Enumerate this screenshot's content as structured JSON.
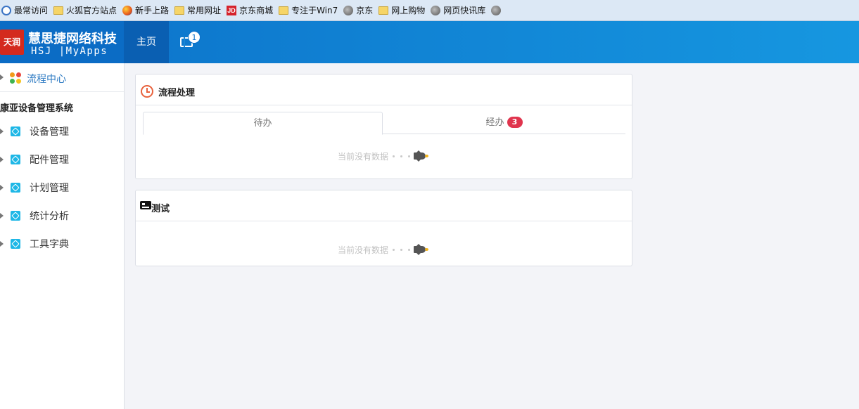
{
  "bookmarks": [
    {
      "label": "最常访问",
      "icon": "most-visited-icon"
    },
    {
      "label": "火狐官方站点",
      "icon": "folder-icon"
    },
    {
      "label": "新手上路",
      "icon": "firefox-icon"
    },
    {
      "label": "常用网址",
      "icon": "folder-icon"
    },
    {
      "label": "京东商城",
      "icon": "jd-icon"
    },
    {
      "label": "专注于Win7",
      "icon": "folder-icon"
    },
    {
      "label": "京东",
      "icon": "globe-icon"
    },
    {
      "label": "网上购物",
      "icon": "folder-icon"
    },
    {
      "label": "网页快讯库",
      "icon": "globe-icon"
    },
    {
      "label": "",
      "icon": "globe-icon"
    }
  ],
  "header": {
    "logo_badge": "天润",
    "brand_title": "慧思捷网络科技",
    "brand_sub": "HSJ |MyApps",
    "nav_home": "主页",
    "apps_badge": "1"
  },
  "sidebar": {
    "process_center": "流程中心",
    "section_title": "康亚设备管理系统",
    "items": [
      {
        "label": "设备管理"
      },
      {
        "label": "配件管理"
      },
      {
        "label": "计划管理"
      },
      {
        "label": "统计分析"
      },
      {
        "label": "工具字典"
      }
    ]
  },
  "panels": {
    "process": {
      "title": "流程处理",
      "tab_todo": "待办",
      "tab_done": "经办",
      "tab_done_badge": "3",
      "empty_text": "当前没有数据"
    },
    "test": {
      "title": "测试",
      "empty_text": "当前没有数据"
    }
  },
  "colors": {
    "header_start": "#0c71c9",
    "header_end": "#1697e0",
    "active_text": "#2b79c2",
    "badge_red": "#e0344d",
    "module_icon": "#1eb7e6"
  }
}
